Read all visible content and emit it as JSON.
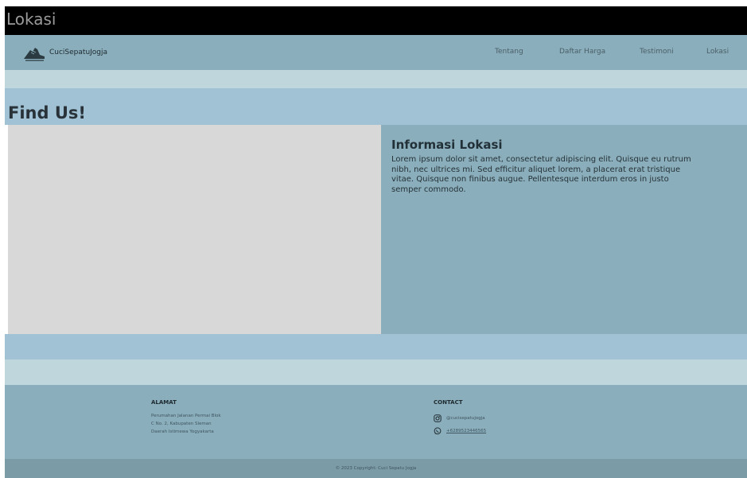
{
  "window": {
    "title": "Lokasi"
  },
  "navbar": {
    "brand": "CuciSepatuJogja",
    "brand_icon": "shoe-icon",
    "items": [
      {
        "label": "Tentang"
      },
      {
        "label": "Daftar Harga"
      },
      {
        "label": "Testimoni"
      },
      {
        "label": "Lokasi"
      }
    ]
  },
  "main": {
    "heading": "Find Us!",
    "info": {
      "title": "Informasi Lokasi",
      "body": "Lorem ipsum dolor sit amet, consectetur adipiscing elit. Quisque eu rutrum nibh, nec ultrices mi. Sed efficitur aliquet lorem, a placerat erat tristique vitae. Quisque non finibus augue. Pellentesque interdum eros in justo semper commodo."
    }
  },
  "footer": {
    "address": {
      "heading": "ALAMAT",
      "lines": [
        "Perumahan Jalanan Permai Blok",
        "C No. 2, Kabupaten Sleman",
        "Daerah Istimewa Yogyakarta"
      ]
    },
    "contact": {
      "heading": "CONTACT",
      "instagram": "@cucisepatujogja",
      "whatsapp": "+6289523446565",
      "instagram_icon": "instagram-icon",
      "whatsapp_icon": "whatsapp-icon"
    },
    "copyright": "© 2023 Copyright: Cuci Sepatu Jogja"
  },
  "colors": {
    "title_bar": "#000000",
    "navbar": "#8aaebb",
    "band_light": "#c0d6dd",
    "band_blue": "#a0c2d4",
    "map_placeholder": "#d8d8d8",
    "copyright_bar": "#7b9ba7"
  }
}
